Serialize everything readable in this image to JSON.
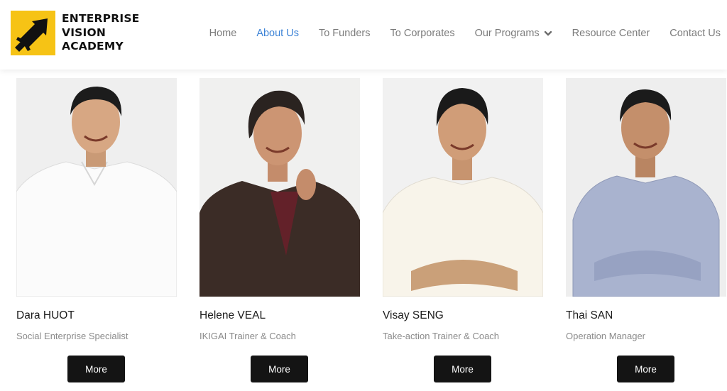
{
  "brand": {
    "lines": [
      "ENTERPRISE",
      "VISION",
      "ACADEMY"
    ],
    "logo_icon": "arrow-plane-icon",
    "accent_color": "#f6c315"
  },
  "nav": {
    "items": [
      {
        "label": "Home"
      },
      {
        "label": "About Us",
        "active": true
      },
      {
        "label": "To Funders"
      },
      {
        "label": "To Corporates"
      },
      {
        "label": "Our Programs",
        "icon": "chevron-down-icon"
      },
      {
        "label": "Resource Center"
      },
      {
        "label": "Contact Us"
      }
    ],
    "active_color": "#3b82d6"
  },
  "team": [
    {
      "name": "Dara HUOT",
      "role": "Social Enterprise Specialist",
      "button": "More",
      "photo_icon": "portrait-photo"
    },
    {
      "name": "Helene VEAL",
      "role": "IKIGAI Trainer & Coach",
      "button": "More",
      "photo_icon": "portrait-photo"
    },
    {
      "name": "Visay SENG",
      "role": "Take-action Trainer & Coach",
      "button": "More",
      "photo_icon": "portrait-photo"
    },
    {
      "name": "Thai SAN",
      "role": "Operation Manager",
      "button": "More",
      "photo_icon": "portrait-photo"
    }
  ]
}
